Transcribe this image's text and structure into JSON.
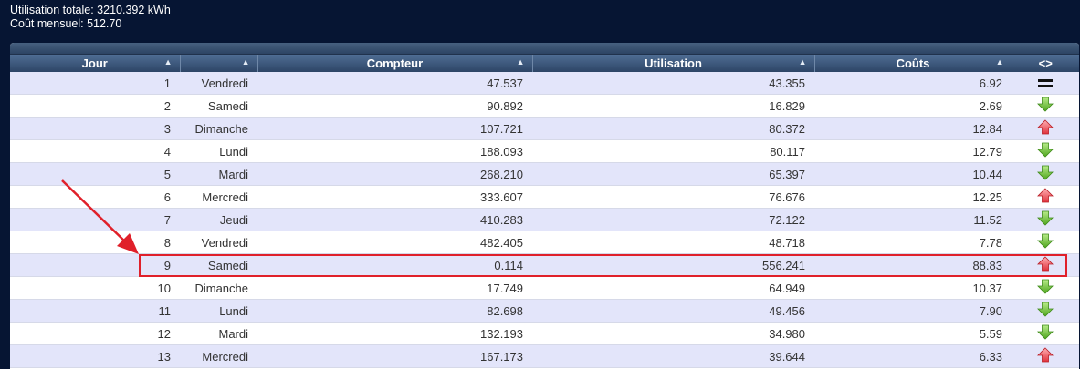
{
  "summary": {
    "total_usage": "Utilisation totale: 3210.392 kWh",
    "monthly_cost": "Coût mensuel: 512.70"
  },
  "table": {
    "headers": [
      "Jour",
      "",
      "Compteur",
      "Utilisation",
      "Coûts",
      "<>"
    ],
    "sort_indicators": [
      "▲",
      "▲",
      "▲",
      "▲",
      "▲",
      ""
    ],
    "rows": [
      {
        "day": "1",
        "weekday": "Vendredi",
        "counter": "47.537",
        "usage": "43.355",
        "cost": "6.92",
        "trend": "equal"
      },
      {
        "day": "2",
        "weekday": "Samedi",
        "counter": "90.892",
        "usage": "16.829",
        "cost": "2.69",
        "trend": "down"
      },
      {
        "day": "3",
        "weekday": "Dimanche",
        "counter": "107.721",
        "usage": "80.372",
        "cost": "12.84",
        "trend": "up"
      },
      {
        "day": "4",
        "weekday": "Lundi",
        "counter": "188.093",
        "usage": "80.117",
        "cost": "12.79",
        "trend": "down"
      },
      {
        "day": "5",
        "weekday": "Mardi",
        "counter": "268.210",
        "usage": "65.397",
        "cost": "10.44",
        "trend": "down"
      },
      {
        "day": "6",
        "weekday": "Mercredi",
        "counter": "333.607",
        "usage": "76.676",
        "cost": "12.25",
        "trend": "up"
      },
      {
        "day": "7",
        "weekday": "Jeudi",
        "counter": "410.283",
        "usage": "72.122",
        "cost": "11.52",
        "trend": "down"
      },
      {
        "day": "8",
        "weekday": "Vendredi",
        "counter": "482.405",
        "usage": "48.718",
        "cost": "7.78",
        "trend": "down"
      },
      {
        "day": "9",
        "weekday": "Samedi",
        "counter": "0.114",
        "usage": "556.241",
        "cost": "88.83",
        "trend": "up"
      },
      {
        "day": "10",
        "weekday": "Dimanche",
        "counter": "17.749",
        "usage": "64.949",
        "cost": "10.37",
        "trend": "down"
      },
      {
        "day": "11",
        "weekday": "Lundi",
        "counter": "82.698",
        "usage": "49.456",
        "cost": "7.90",
        "trend": "down"
      },
      {
        "day": "12",
        "weekday": "Mardi",
        "counter": "132.193",
        "usage": "34.980",
        "cost": "5.59",
        "trend": "down"
      },
      {
        "day": "13",
        "weekday": "Mercredi",
        "counter": "167.173",
        "usage": "39.644",
        "cost": "6.33",
        "trend": "up"
      }
    ]
  },
  "colors": {
    "background": "#061533",
    "header": "#3c5579",
    "row_alt": "#e3e5fa",
    "highlight": "#e0202a",
    "trend_up": "#e8474f",
    "trend_down": "#5cb82a"
  }
}
